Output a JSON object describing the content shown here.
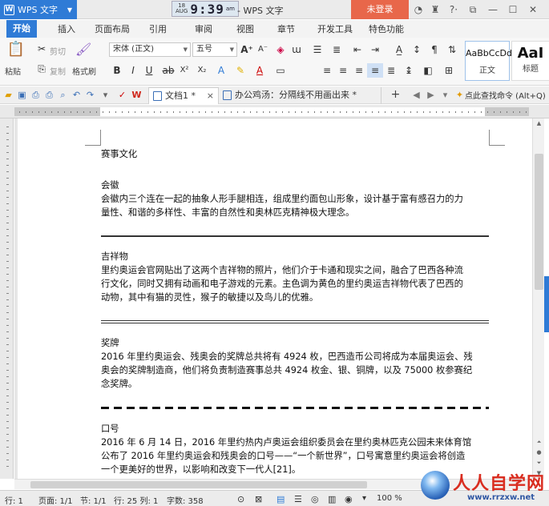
{
  "titlebar": {
    "app_button": "WPS 文字",
    "clock_date_top": "18",
    "clock_date_bottom": "AUG",
    "clock_time": "9:39",
    "clock_ampm": "am",
    "window_title": "- WPS 文字",
    "login": "未登录"
  },
  "tabs": [
    "开始",
    "插入",
    "页面布局",
    "引用",
    "审阅",
    "视图",
    "章节",
    "开发工具",
    "特色功能"
  ],
  "ribbon": {
    "paste": "粘贴",
    "cut": "剪切",
    "copy": "复制",
    "format_painter": "格式刷",
    "font_name": "宋体 (正文)",
    "font_size": "五号",
    "style1_sample": "AaBbCcDd",
    "style1_label": "正文",
    "style2_sample": "AaI",
    "style2_label": "标题"
  },
  "doctabs": {
    "tab1": "文档1 *",
    "tab2": "办公鸡汤：分隔线不用画出来 *",
    "search": "点此查找命令 (Alt+Q)"
  },
  "document": {
    "title": "赛事文化",
    "s1_heading": "会徽",
    "s1_line1": "会徽内三个连在一起的抽象人形手腿相连，组成里约面包山形象，设计基于富有感召力的力",
    "s1_line2": "量性、和谐的多样性、丰富的自然性和奥林匹克精神极大理念。",
    "s2_heading": "吉祥物",
    "s2_line1": "里约奥运会官网贴出了这两个吉祥物的照片，他们介于卡通和现实之间，融合了巴西各种流",
    "s2_line2": "行文化，同时又拥有动画和电子游戏的元素。主色调为黄色的里约奥运吉祥物代表了巴西的",
    "s2_line3": "动物，其中有猫的灵性，猴子的敏捷以及鸟儿的优雅。",
    "s3_heading": "奖牌",
    "s3_line1": "2016 年里约奥运会、残奥会的奖牌总共将有 4924 枚，巴西造币公司将成为本届奥运会、残",
    "s3_line2": "奥会的奖牌制造商，他们将负责制造赛事总共 4924 枚金、银、铜牌，以及 75000 枚参赛纪",
    "s3_line3": "念奖牌。",
    "s4_heading": "口号",
    "s4_line1": "2016 年 6 月 14 日，2016 年里约热内卢奥运会组织委员会在里约奥林匹克公园未来体育馆",
    "s4_line2": "公布了 2016 年里约奥运会和残奥会的口号——“一个新世界”，口号寓意里约奥运会将创造",
    "s4_line3": "一个更美好的世界，以影响和改变下一代人[21]。"
  },
  "status": {
    "row": "行: 1",
    "page": "页面: 1/1",
    "section": "节: 1/1",
    "line_col": "行: 25  列: 1",
    "words": "字数: 358",
    "zoom": "100 %"
  },
  "watermark": {
    "brand": "人人自学网",
    "url": "www.rrzxw.net"
  }
}
